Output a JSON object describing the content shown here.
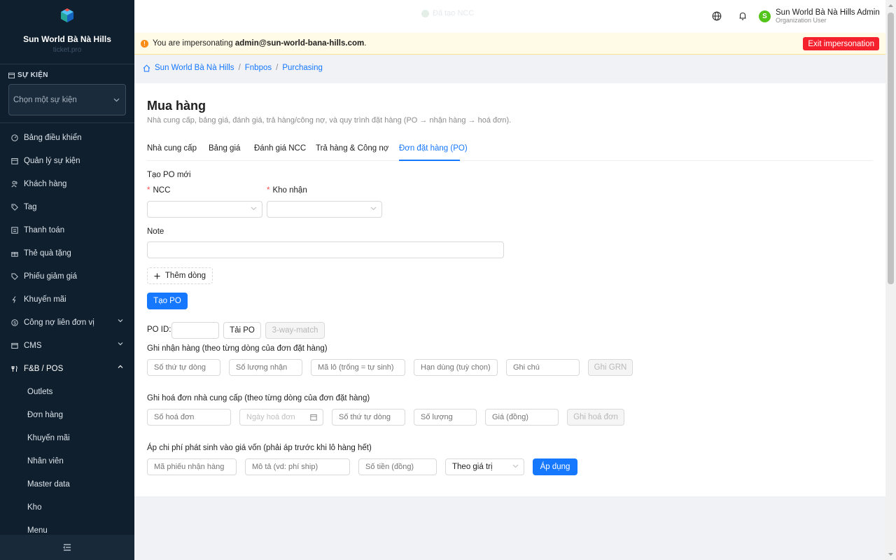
{
  "sidebar": {
    "brand_name": "Sun World Bà Nà Hills",
    "brand_sub": "ticket.pro",
    "event_label": "SỰ KIỆN",
    "event_placeholder": "Chọn một sự kiện",
    "items": [
      {
        "label": "Bảng điều khiển",
        "icon": "dashboard-icon"
      },
      {
        "label": "Quản lý sự kiện",
        "icon": "calendar-icon"
      },
      {
        "label": "Khách hàng",
        "icon": "users-icon"
      },
      {
        "label": "Tag",
        "icon": "tag-icon"
      },
      {
        "label": "Thanh toán",
        "icon": "payment-icon"
      },
      {
        "label": "Thẻ quà tặng",
        "icon": "gift-icon"
      },
      {
        "label": "Phiếu giảm giá",
        "icon": "coupon-icon"
      },
      {
        "label": "Khuyến mãi",
        "icon": "promo-icon"
      },
      {
        "label": "Công nợ liên đơn vị",
        "icon": "debt-icon"
      },
      {
        "label": "CMS",
        "icon": "cms-icon"
      },
      {
        "label": "F&B / POS",
        "icon": "pos-icon"
      }
    ],
    "sub_items": [
      "Outlets",
      "Đơn hàng",
      "Khuyến mãi",
      "Nhân viên",
      "Master data",
      "Kho",
      "Menu"
    ]
  },
  "header": {
    "ghost_badge": "Đã tạo NCC",
    "user_name": "Sun World Bà Nà Hills Admin",
    "user_role": "Organization User",
    "avatar_letter": "S"
  },
  "banner": {
    "prefix": "You are impersonating",
    "email": "admin@sun-world-bana-hills.com",
    "suffix": ".",
    "exit_label": "Exit impersonation"
  },
  "breadcrumb": [
    "Sun World Bà Nà Hills",
    "Fnbpos",
    "Purchasing"
  ],
  "page": {
    "title": "Mua hàng",
    "description": "Nhà cung cấp, bảng giá, đánh giá, trả hàng/công nợ, và quy trình đặt hàng (PO → nhận hàng → hoá đơn).",
    "tabs": [
      "Nhà cung cấp",
      "Bảng giá",
      "Đánh giá NCC",
      "Trả hàng & Công nợ",
      "Đơn đặt hàng (PO)"
    ]
  },
  "po_form": {
    "section_title": "Tạo PO mới",
    "ncc_label": "NCC",
    "kho_label": "Kho nhận",
    "note_label": "Note",
    "add_row_label": "Thêm dòng",
    "create_label": "Tạo PO"
  },
  "po_lookup": {
    "id_label": "PO ID:",
    "load_label": "Tải PO",
    "match_label": "3-way-match"
  },
  "grn": {
    "title": "Ghi nhận hàng (theo từng dòng của đơn đặt hàng)",
    "placeholders": [
      "Số thứ tự dòng",
      "Số lượng nhận",
      "Mã lô (trống = tự sinh)",
      "Hạn dùng (tuỳ chọn)",
      "Ghi chú"
    ],
    "button": "Ghi GRN"
  },
  "invoice": {
    "title": "Ghi hoá đơn nhà cung cấp (theo từng dòng của đơn đặt hàng)",
    "placeholders": [
      "Số hoá đơn",
      "Ngày hoá đơn",
      "Số thứ tự dòng",
      "Số lượng",
      "Giá (đồng)"
    ],
    "button": "Ghi hoá đơn"
  },
  "landed_cost": {
    "title": "Áp chi phí phát sinh vào giá vốn (phải áp trước khi lô hàng hết)",
    "placeholders": [
      "Mã phiếu nhận hàng",
      "Mô tả (vd: phí ship)",
      "Số tiền (đồng)"
    ],
    "method_value": "Theo giá trị",
    "apply_label": "Áp dụng"
  },
  "colors": {
    "sidebar_bg": "#0f1f2e",
    "primary": "#1677ff",
    "danger": "#f5222d",
    "warning_bg": "#fffbe6"
  }
}
